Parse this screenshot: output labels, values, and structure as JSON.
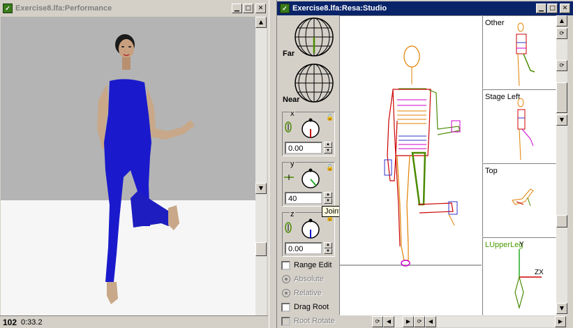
{
  "performance_window": {
    "title": "Exercise8.lfa:Performance",
    "frame_number": "102",
    "time": "0:33.2"
  },
  "studio_window": {
    "title": "Exercise8.lfa:Resa:Studio",
    "far_label": "Far",
    "near_label": "Near",
    "x_axis": {
      "label": "x",
      "value": "0.00"
    },
    "y_axis": {
      "label": "y",
      "value": "40"
    },
    "z_axis": {
      "label": "z",
      "value": "0.00"
    },
    "tooltip": "Joint angle field",
    "range_edit_label": "Range Edit",
    "absolute_label": "Absolute",
    "relative_label": "Relative",
    "drag_root_label": "Drag Root",
    "root_rotate_label": "Root Rotate",
    "views": {
      "other": "Other",
      "stage_left": "Stage Left",
      "top": "Top",
      "segment": "LUpperLeg"
    },
    "axis_y": "Y",
    "axis_zx": "ZX"
  },
  "colors": {
    "title_active": "#0a246a",
    "figure_body": "#1a1acc",
    "skin": "#c8a888",
    "skeleton_red": "#cc0000",
    "skeleton_green": "#4a8a00",
    "skeleton_orange": "#e08000",
    "segment_label": "#4a9a00"
  }
}
